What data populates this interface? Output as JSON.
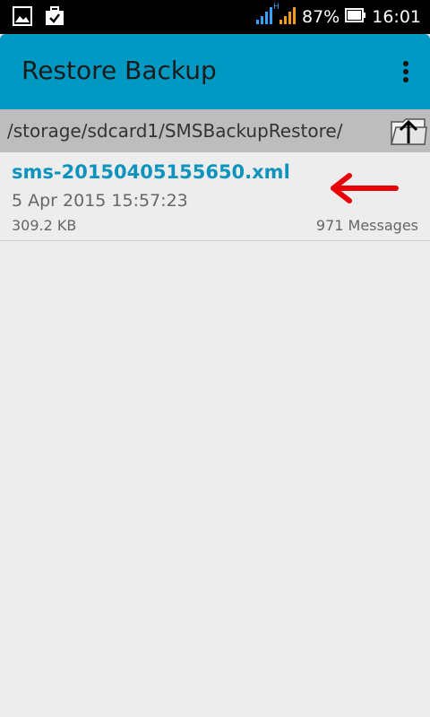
{
  "status_bar": {
    "network_type": "H",
    "battery": "87%",
    "time": "16:01",
    "icons": [
      "image-icon",
      "briefcase-check-icon",
      "wifi-signal-icon",
      "cell-signal-icon",
      "battery-icon"
    ]
  },
  "app_bar": {
    "title": "Restore Backup",
    "overflow_icon": "more-vert-icon"
  },
  "path_bar": {
    "path": "/storage/sdcard1/SMSBackupRestore/",
    "up_icon": "folder-up-icon"
  },
  "files": [
    {
      "name": "sms-20150405155650.xml",
      "date": "5 Apr 2015 15:57:23",
      "size": "309.2 KB",
      "messages": "971 Messages"
    }
  ],
  "colors": {
    "app_bar": "#0099c4",
    "file_name": "#0e93bd",
    "path_bar": "#bdbdbd",
    "background": "#ededed",
    "annotation_arrow": "#e8000b"
  }
}
